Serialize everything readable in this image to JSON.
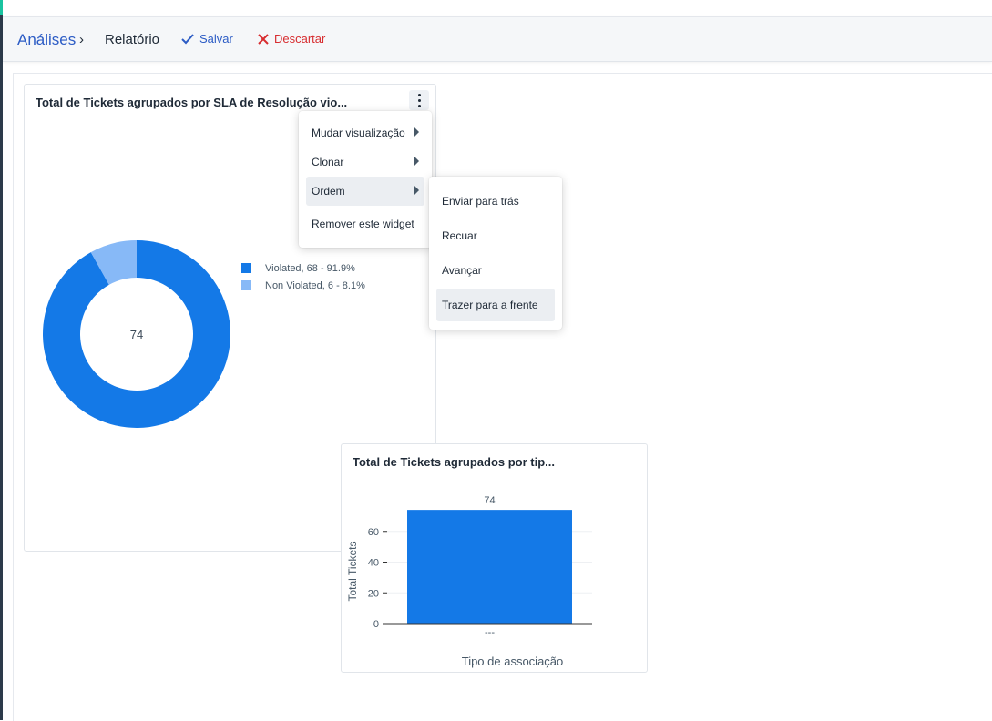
{
  "header": {
    "breadcrumb_root": "Análises",
    "breadcrumb_current": "Relatório",
    "save_label": "Salvar",
    "discard_label": "Descartar"
  },
  "widget1": {
    "title": "Total de Tickets agrupados por SLA de Resolução vio...",
    "center_total": "74",
    "legend": [
      {
        "label": "Violated,  68 - 91.9%",
        "color": "#1479e7"
      },
      {
        "label": "Non Violated,  6 - 8.1%",
        "color": "#87b9f7"
      }
    ]
  },
  "context_menu": {
    "items": [
      {
        "label": "Mudar visualização",
        "submenu": true
      },
      {
        "label": "Clonar",
        "submenu": true
      },
      {
        "label": "Ordem",
        "submenu": true
      },
      {
        "label": "Remover este widget",
        "submenu": false
      }
    ]
  },
  "order_submenu": {
    "items": [
      {
        "label": "Enviar para trás"
      },
      {
        "label": "Recuar"
      },
      {
        "label": "Avançar"
      },
      {
        "label": "Trazer para a frente"
      }
    ]
  },
  "widget2": {
    "title": "Total de Tickets agrupados por tip..."
  },
  "chart_data": [
    {
      "type": "pie",
      "categories": [
        "Violated",
        "Non Violated"
      ],
      "values": [
        68,
        6
      ],
      "percentages": [
        91.9,
        8.1
      ],
      "center_label": "74",
      "colors": [
        "#1479e7",
        "#87b9f7"
      ],
      "legend_position": "right"
    },
    {
      "type": "bar",
      "categories": [
        "---"
      ],
      "values": [
        74
      ],
      "data_labels": [
        "74"
      ],
      "xlabel": "Tipo de associação",
      "ylabel": "Total Tickets",
      "yticks": [
        0,
        20,
        40,
        60
      ],
      "ylim": [
        0,
        80
      ],
      "grid": true,
      "color": "#1479e7"
    }
  ]
}
